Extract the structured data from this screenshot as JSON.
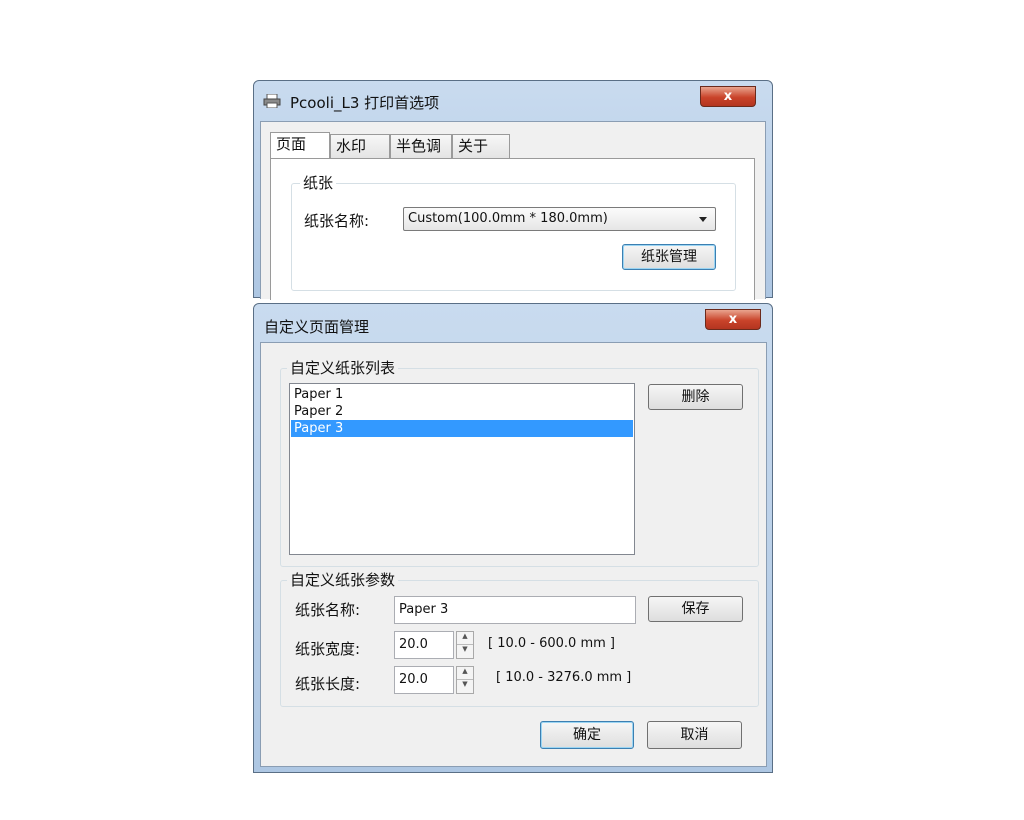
{
  "printer_dialog": {
    "title": "Pcooli_L3 打印首选项",
    "close_label": "x",
    "tabs": [
      "页面",
      "水印",
      "半色调",
      "关于"
    ],
    "paper_group_label": "纸张",
    "paper_name_label": "纸张名称:",
    "paper_name_value": "Custom(100.0mm * 180.0mm)",
    "paper_manage_button": "纸张管理"
  },
  "custom_page_dialog": {
    "title": "自定义页面管理",
    "close_label": "x",
    "list_group_label": "自定义纸张列表",
    "papers": [
      "Paper 1",
      "Paper 2",
      "Paper 3"
    ],
    "selected_index": 2,
    "delete_button": "删除",
    "params_group_label": "自定义纸张参数",
    "name_label": "纸张名称:",
    "name_value": "Paper 3",
    "save_button": "保存",
    "width_label": "纸张宽度:",
    "width_value": "20.0",
    "width_range": "[ 10.0 - 600.0 mm ]",
    "length_label": "纸张长度:",
    "length_value": "20.0",
    "length_range": "[ 10.0 - 3276.0 mm ]",
    "ok_button": "确定",
    "cancel_button": "取消"
  },
  "colors": {
    "selection": "#3399ff",
    "close_button": "#c9432a",
    "window_frame": "#aec7e3"
  }
}
